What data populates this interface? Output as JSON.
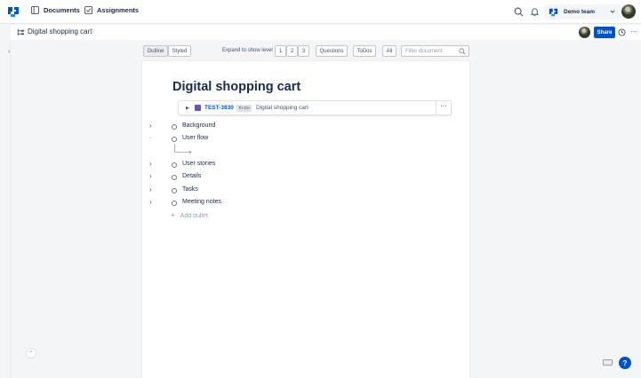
{
  "nav": {
    "documents": "Documents",
    "assignments": "Assignments"
  },
  "team": {
    "name": "Demo team"
  },
  "document": {
    "breadcrumb_title": "Digital shopping cart",
    "title": "Digital shopping cart",
    "share_label": "Share"
  },
  "toolbar": {
    "outline": "Outline",
    "styled": "Styled",
    "expand_label": "Expand to show level",
    "level1": "1",
    "level2": "2",
    "level3": "3",
    "questions": "Questions",
    "todos": "ToDos",
    "all": "All",
    "filter_placeholder": "Filter document"
  },
  "issue": {
    "key": "TEST-3830",
    "status": "To Do",
    "summary": "Digital shopping cart"
  },
  "bullets": {
    "background": "Background",
    "user_flow": "User flow",
    "user_stories": "User stories",
    "details": "Details",
    "tasks": "Tasks",
    "meeting_notes": "Meeting notes"
  },
  "add_bullet": "Add bullet",
  "help": "?",
  "icons": {
    "logo": "logo-icon",
    "search": "search-icon",
    "bell": "bell-icon",
    "star": "star-icon",
    "more": "more-icon"
  },
  "colors": {
    "primary": "#0052cc",
    "epic": "#6554c0"
  }
}
